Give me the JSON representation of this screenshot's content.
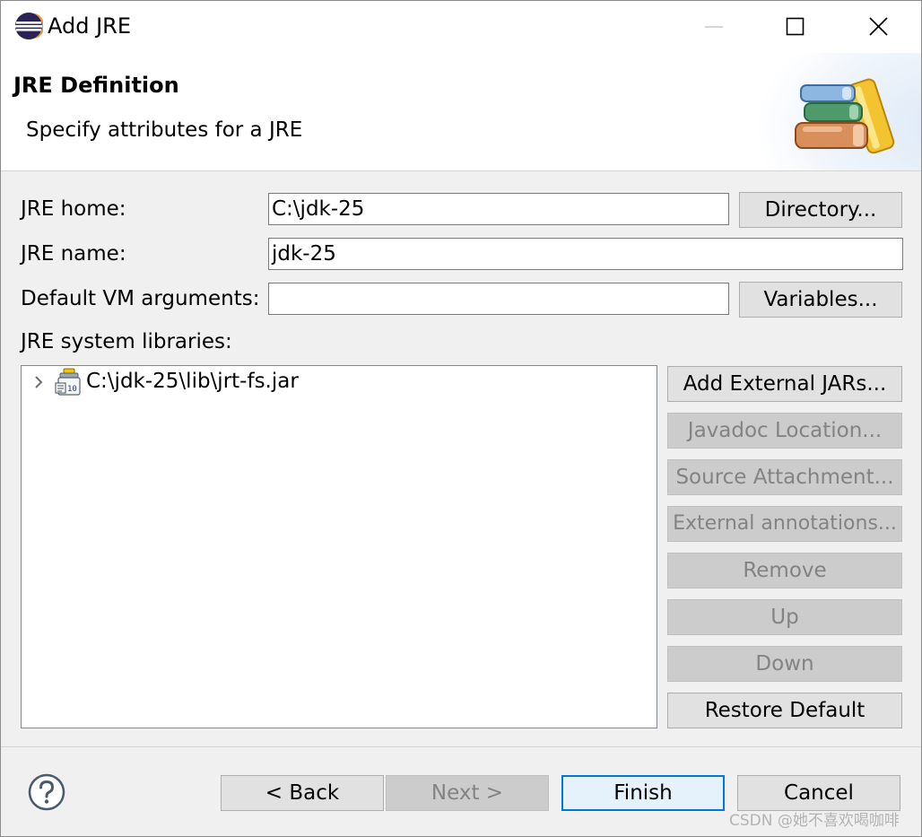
{
  "window": {
    "title": "Add JRE",
    "icon": "eclipse-icon",
    "controls": {
      "minimize": "minimize-icon",
      "maximize": "maximize-icon",
      "close": "close-icon"
    }
  },
  "banner": {
    "title": "JRE Definition",
    "description": "Specify attributes for a JRE",
    "image": "jre-books-icon"
  },
  "form": {
    "jre_home": {
      "label": "JRE home:",
      "value": "C:\\jdk-25",
      "button": "Directory..."
    },
    "jre_name": {
      "label": "JRE name:",
      "value": "jdk-25"
    },
    "vm_args": {
      "label": "Default VM arguments:",
      "value": "",
      "button": "Variables..."
    },
    "libraries_label": "JRE system libraries:"
  },
  "libraries": {
    "items": [
      {
        "label": "C:\\jdk-25\\lib\\jrt-fs.jar",
        "icon": "jar-file-icon",
        "expanded": false
      }
    ]
  },
  "library_buttons": {
    "add_external_jars": "Add External JARs...",
    "javadoc_location": "Javadoc Location...",
    "source_attachment": "Source Attachment...",
    "external_annotations": "External annotations...",
    "remove": "Remove",
    "up": "Up",
    "down": "Down",
    "restore_default": "Restore Default"
  },
  "footer": {
    "help_icon": "help-icon",
    "back": "< Back",
    "next": "Next >",
    "finish": "Finish",
    "cancel": "Cancel"
  },
  "watermark": "CSDN @她不喜欢喝咖啡",
  "colors": {
    "focus_border": "#0078d7",
    "disabled_text": "#838383",
    "dialog_background": "#f0f0f0"
  }
}
